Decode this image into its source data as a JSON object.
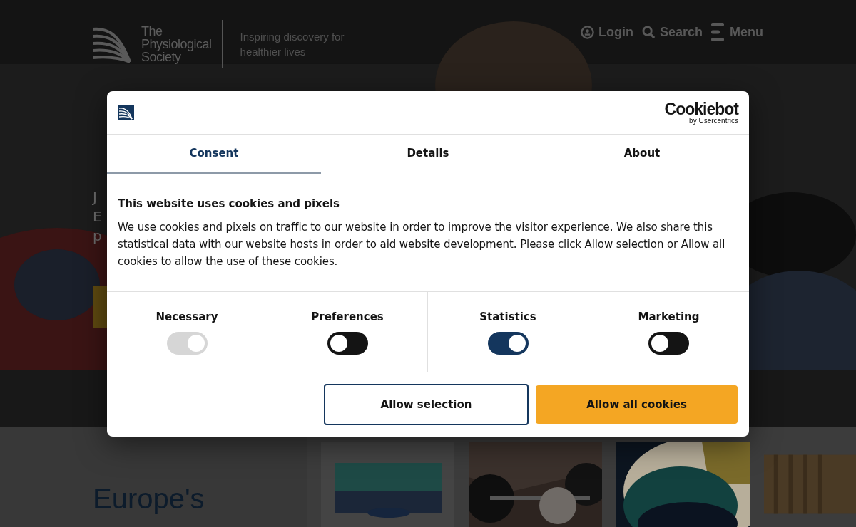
{
  "header": {
    "logo_lines": [
      "The",
      "Physiological",
      "Society"
    ],
    "tagline": "Inspiring discovery for healthier lives",
    "nav": [
      {
        "kind": "login",
        "label": "Login"
      },
      {
        "kind": "search",
        "label": "Search"
      },
      {
        "kind": "menu",
        "label": "Menu"
      }
    ]
  },
  "hero": {
    "lines": [
      "J",
      "E",
      "p"
    ]
  },
  "section": {
    "heading": "Europe's"
  },
  "cookie_dialog": {
    "brand": {
      "name": "Cookiebot",
      "tagline": "by Usercentrics"
    },
    "tabs": [
      {
        "label": "Consent",
        "selected": true
      },
      {
        "label": "Details",
        "selected": false
      },
      {
        "label": "About",
        "selected": false
      }
    ],
    "title": "This website uses cookies and pixels",
    "text": "We use cookies and pixels on traffic to our website in order to improve the visitor experience. We also share this statistical data with our website hosts in order to aid website development. Please click Allow selection or Allow all cookies to allow the use of these cookies.",
    "categories": [
      {
        "label": "Necessary",
        "checked": true,
        "disabled": true
      },
      {
        "label": "Preferences",
        "checked": false,
        "disabled": false
      },
      {
        "label": "Statistics",
        "checked": true,
        "disabled": false
      },
      {
        "label": "Marketing",
        "checked": false,
        "disabled": false
      }
    ],
    "buttons": [
      {
        "kind": "outline",
        "label": "Allow selection"
      },
      {
        "kind": "primary",
        "label": "Allow all cookies"
      }
    ]
  }
}
